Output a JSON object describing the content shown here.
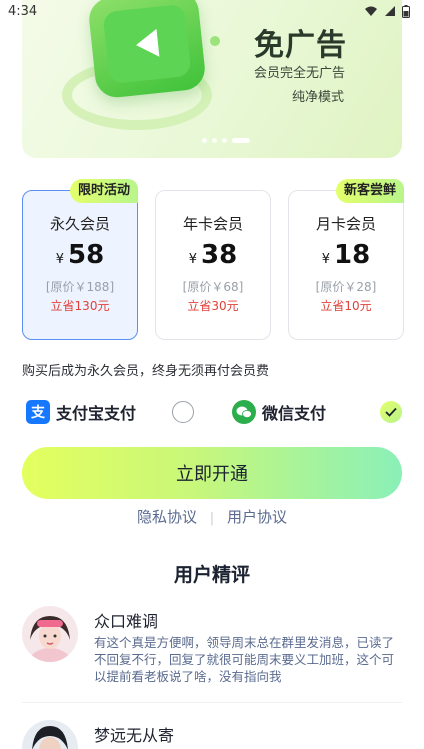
{
  "status_bar": {
    "time": "4:34"
  },
  "banner": {
    "headline": "免广告",
    "line1": "会员完全无广告",
    "line2": "纯净模式",
    "carousel": {
      "count": 4,
      "active_index": 3
    }
  },
  "plans": [
    {
      "name": "永久会员",
      "currency": "¥",
      "price": "58",
      "original": "[原价￥188]",
      "save": "立省130元",
      "tag": "限时活动",
      "selected": true
    },
    {
      "name": "年卡会员",
      "currency": "¥",
      "price": "38",
      "original": "[原价￥68]",
      "save": "立省30元",
      "tag": "",
      "selected": false
    },
    {
      "name": "月卡会员",
      "currency": "¥",
      "price": "18",
      "original": "[原价￥28]",
      "save": "立省10元",
      "tag": "新客尝鲜",
      "selected": false
    }
  ],
  "note": "购买后成为永久会员，终身无须再付会员费",
  "payment": {
    "alipay": {
      "label": "支付宝支付",
      "icon": "alipay-icon",
      "icon_glyph": "支",
      "selected": false
    },
    "wechat": {
      "label": "微信支付",
      "icon": "wechat-icon",
      "selected": true
    }
  },
  "cta": {
    "label": "立即开通"
  },
  "agreements": {
    "privacy": "隐私协议",
    "separator": "|",
    "user": "用户协议"
  },
  "reviews": {
    "title": "用户精评",
    "items": [
      {
        "user": "众口难调",
        "text": "有这个真是方便啊，领导周末总在群里发消息，已读了不回复不行，回复了就很可能周末要义工加班，这个可以提前看老板说了啥，没有指向我"
      },
      {
        "user": "梦远无从寄",
        "text": ""
      }
    ]
  },
  "colors": {
    "accent_green": "#c8f77a",
    "selected_border": "#5b8ff5",
    "save_red": "#e0403a",
    "link_blue_gray": "#5a6b8f"
  }
}
